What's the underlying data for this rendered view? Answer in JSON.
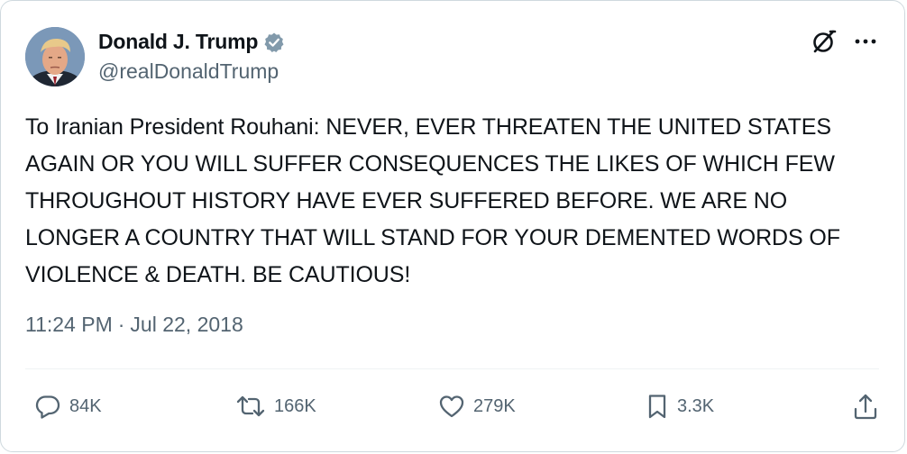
{
  "author": {
    "name": "Donald J. Trump",
    "handle": "@realDonaldTrump",
    "verified_color": "#829aab"
  },
  "header_icons": [
    "grok-icon",
    "more-icon"
  ],
  "tweet": {
    "text": "To Iranian President Rouhani: NEVER, EVER THREATEN THE UNITED STATES AGAIN OR YOU WILL SUFFER CONSEQUENCES THE LIKES OF WHICH FEW THROUGHOUT HISTORY HAVE EVER SUFFERED BEFORE. WE ARE NO LONGER A COUNTRY THAT WILL STAND FOR YOUR DEMENTED WORDS OF VIOLENCE & DEATH. BE CAUTIOUS!",
    "time": "11:24 PM",
    "separator": "·",
    "date": "Jul 22, 2018"
  },
  "actions": {
    "replies": "84K",
    "retweets": "166K",
    "likes": "279K",
    "bookmarks": "3.3K"
  },
  "colors": {
    "text": "#0f1419",
    "secondary": "#536471",
    "border": "#cfd9de"
  }
}
